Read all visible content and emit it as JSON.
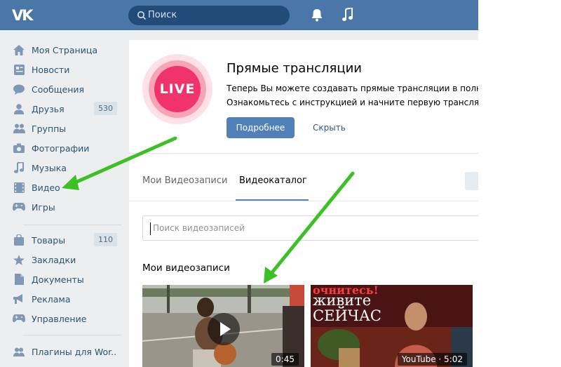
{
  "header": {
    "logo_text": "VK",
    "search_placeholder": "Поиск",
    "brand_color": "#4a76a8"
  },
  "sidebar": {
    "items": [
      {
        "label": "Моя Страница",
        "icon": "home-icon"
      },
      {
        "label": "Новости",
        "icon": "news-icon"
      },
      {
        "label": "Сообщения",
        "icon": "messages-icon"
      },
      {
        "label": "Друзья",
        "icon": "friends-icon",
        "badge": "530"
      },
      {
        "label": "Группы",
        "icon": "groups-icon"
      },
      {
        "label": "Фотографии",
        "icon": "camera-icon"
      },
      {
        "label": "Музыка",
        "icon": "music-icon"
      },
      {
        "label": "Видео",
        "icon": "video-icon"
      },
      {
        "label": "Игры",
        "icon": "gamepad-icon"
      },
      {
        "label": "Товары",
        "icon": "bag-icon",
        "badge": "110"
      },
      {
        "label": "Закладки",
        "icon": "star-icon"
      },
      {
        "label": "Документы",
        "icon": "document-icon"
      },
      {
        "label": "Реклама",
        "icon": "megaphone-icon"
      },
      {
        "label": "Управление",
        "icon": "gamepad-icon"
      },
      {
        "label": "Плагины для Wor..",
        "icon": "apps-icon"
      }
    ]
  },
  "live": {
    "badge": "LIVE",
    "title": "Прямые трансляции",
    "desc_line1": "Теперь Вы можете создавать прямые трансляции в полно",
    "desc_line2": "Ознакомьтесь с инструкцией и начните первую трансляци",
    "more_label": "Подробнее",
    "hide_label": "Скрыть"
  },
  "tabs": {
    "my_videos": "Мои Видеозаписи",
    "catalog": "Видеокаталог"
  },
  "video_search": {
    "placeholder": "Поиск видеозаписей"
  },
  "my_videos": {
    "title": "Мои видеозаписи",
    "videos": [
      {
        "duration": "0:45"
      },
      {
        "duration": "YouTube · 5:02",
        "overlay_line1": "очнитесь!",
        "overlay_line2": "живите",
        "overlay_line3": "СЕЙЧАС"
      }
    ]
  },
  "colors": {
    "accent": "#5181b8",
    "link": "#2a5885",
    "live_pink": "#f0346b",
    "arrow_green": "#3cc026"
  }
}
